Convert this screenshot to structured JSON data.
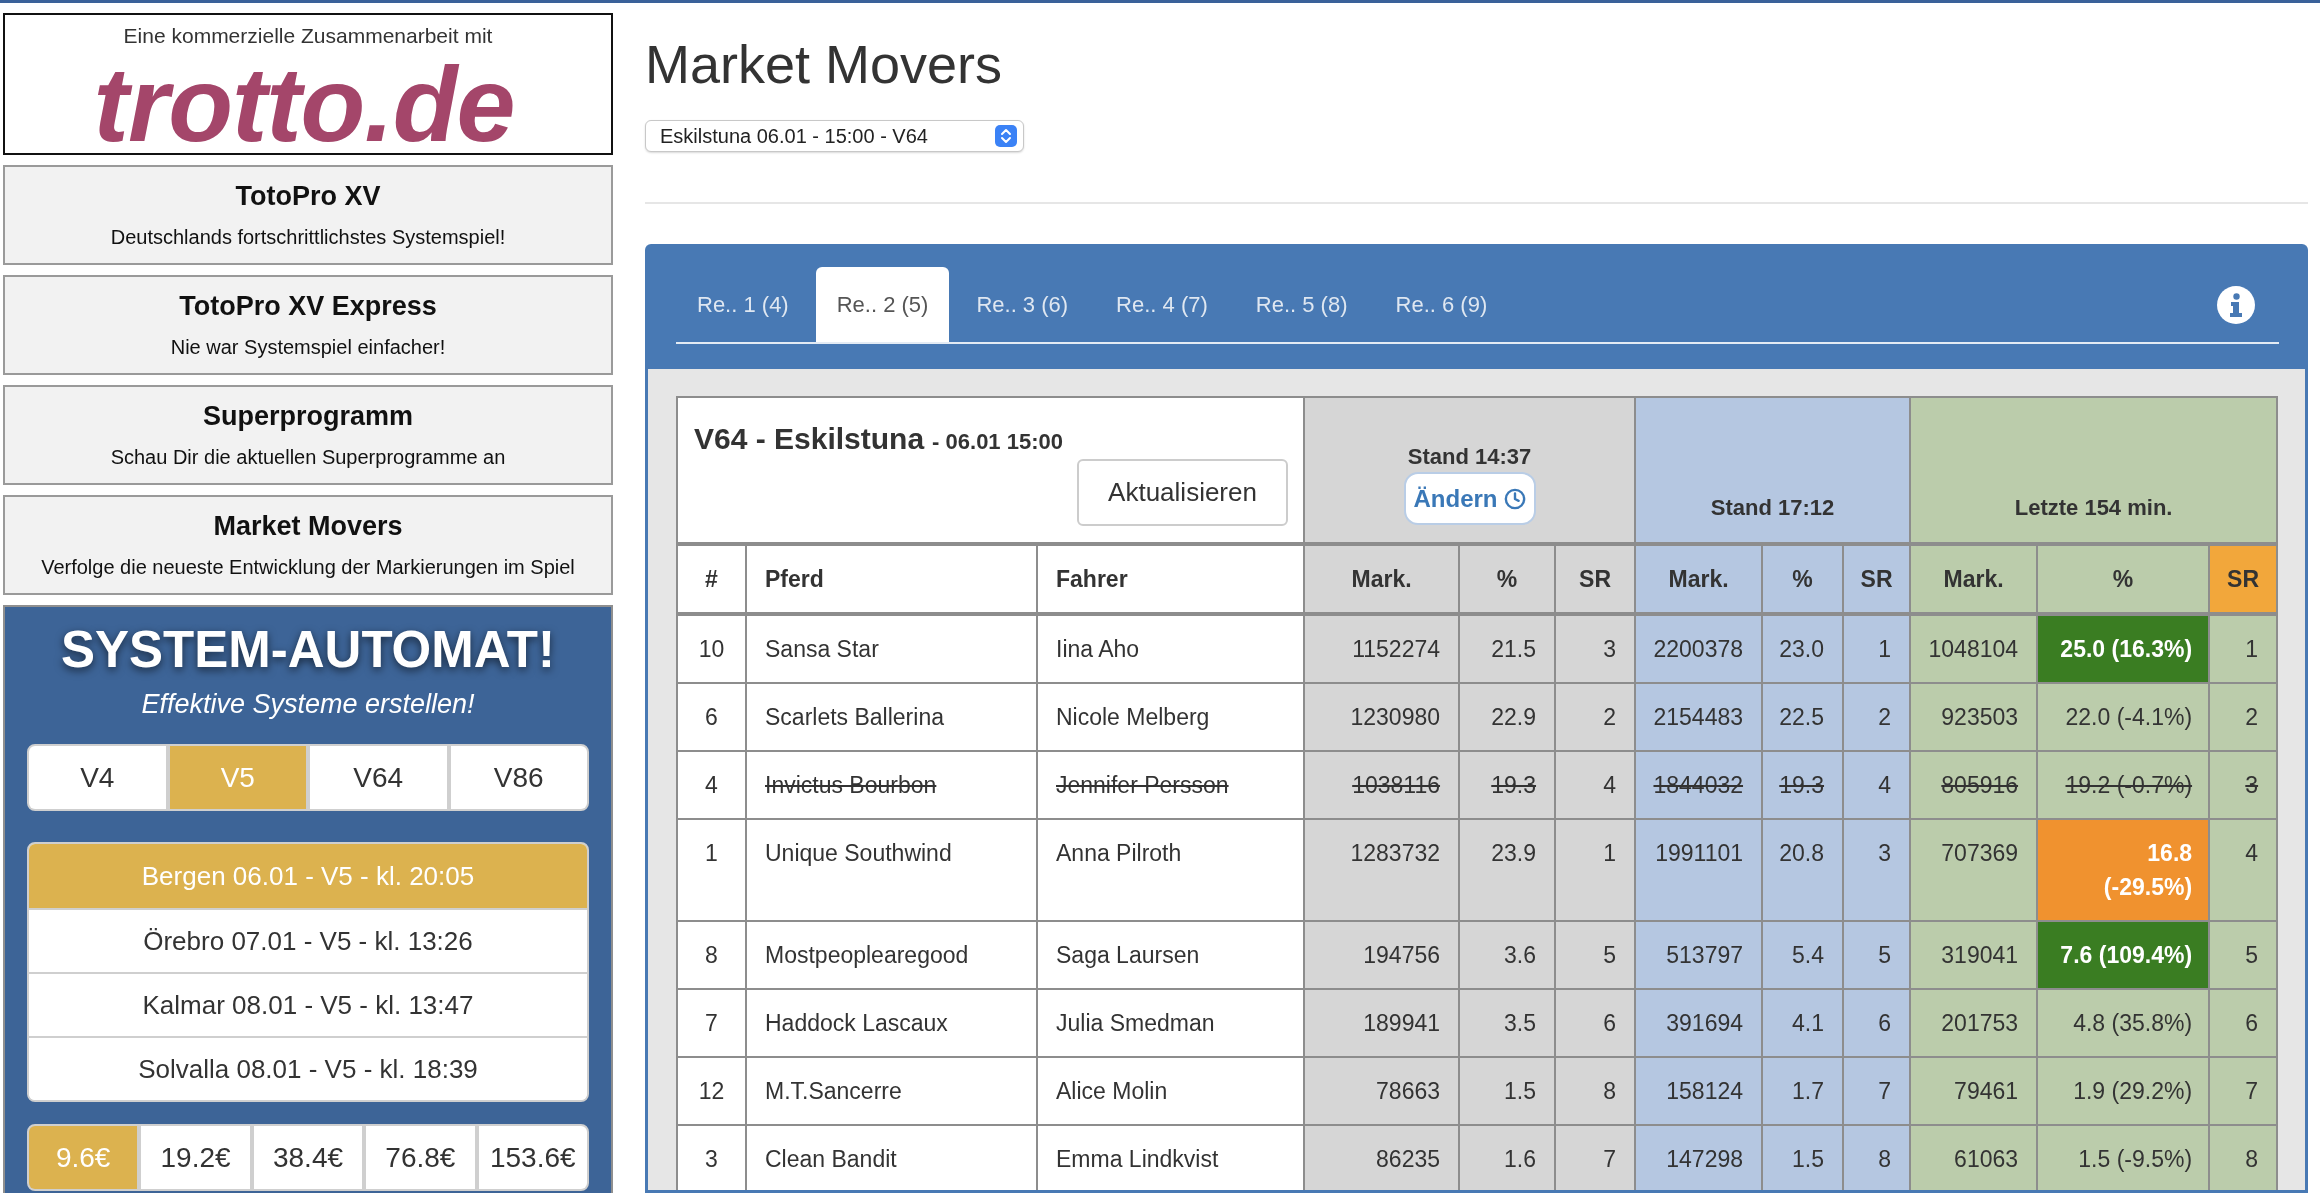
{
  "partner_banner": {
    "caption": "Eine kommerzielle Zusammenarbeit mit",
    "logo": "trotto.de"
  },
  "promo_links": [
    {
      "title": "TotoPro XV",
      "subtitle": "Deutschlands fortschrittlichstes Systemspiel!"
    },
    {
      "title": "TotoPro XV Express",
      "subtitle": "Nie war Systemspiel einfacher!"
    },
    {
      "title": "Superprogramm",
      "subtitle": "Schau Dir die aktuellen Superprogramme an"
    },
    {
      "title": "Market Movers",
      "subtitle": "Verfolge die neueste Entwicklung der Markierungen im Spiel"
    }
  ],
  "system_automat": {
    "title": "SYSTEM-AUTOMAT!",
    "subtitle": "Effektive Systeme erstellen!",
    "game_types": [
      {
        "label": "V4",
        "selected": false
      },
      {
        "label": "V5",
        "selected": true
      },
      {
        "label": "V64",
        "selected": false
      },
      {
        "label": "V86",
        "selected": false
      }
    ],
    "races": [
      {
        "label": "Bergen 06.01 - V5 - kl. 20:05",
        "selected": true
      },
      {
        "label": "Örebro 07.01 - V5 - kl. 13:26",
        "selected": false
      },
      {
        "label": "Kalmar 08.01 - V5 - kl. 13:47",
        "selected": false
      },
      {
        "label": "Solvalla 08.01 - V5 - kl. 18:39",
        "selected": false
      }
    ],
    "stakes": [
      {
        "label": "9.6€",
        "selected": true
      },
      {
        "label": "19.2€",
        "selected": false
      },
      {
        "label": "38.4€",
        "selected": false
      },
      {
        "label": "76.8€",
        "selected": false
      },
      {
        "label": "153.6€",
        "selected": false
      }
    ]
  },
  "page": {
    "title": "Market Movers",
    "race_select": {
      "value": "Eskilstuna 06.01 - 15:00 - V64"
    }
  },
  "race_tabs": [
    {
      "label": "Re.. 1 (4)",
      "selected": false
    },
    {
      "label": "Re.. 2 (5)",
      "selected": true
    },
    {
      "label": "Re.. 3 (6)",
      "selected": false
    },
    {
      "label": "Re.. 4 (7)",
      "selected": false
    },
    {
      "label": "Re.. 5 (8)",
      "selected": false
    },
    {
      "label": "Re.. 6 (9)",
      "selected": false
    }
  ],
  "table": {
    "title": "V64 - Eskilstuna",
    "subtitle": "- 06.01 15:00",
    "refresh_button": "Aktualisieren",
    "groups": [
      {
        "heading": "Stand 14:37",
        "button": "Ändern",
        "color": "#d6d6d6"
      },
      {
        "heading": "Stand 17:12",
        "color": "#b5c7e1"
      },
      {
        "heading": "Letzte 154 min.",
        "color": "#bbccab"
      }
    ],
    "columns": [
      {
        "label": "#",
        "sorted": false
      },
      {
        "label": "Pferd",
        "sorted": false
      },
      {
        "label": "Fahrer",
        "sorted": false
      },
      {
        "label": "Mark.",
        "sorted": false
      },
      {
        "label": "%",
        "sorted": false
      },
      {
        "label": "SR",
        "sorted": false
      },
      {
        "label": "Mark.",
        "sorted": false
      },
      {
        "label": "%",
        "sorted": false
      },
      {
        "label": "SR",
        "sorted": false
      },
      {
        "label": "Mark.",
        "sorted": false
      },
      {
        "label": "%",
        "sorted": false
      },
      {
        "label": "SR",
        "sorted": true
      }
    ],
    "rows": [
      {
        "number": "10",
        "horse": "Sansa Star",
        "driver": "Iina Aho",
        "scratched": false,
        "values": [
          {
            "kind": "plain",
            "mark": "1152274",
            "pct": "21.5",
            "sr": "3"
          },
          {
            "kind": "plain",
            "mark": "2200378",
            "pct": "23.0",
            "sr": "1"
          },
          {
            "kind": "rise",
            "mark": "1048104",
            "pct": "25.0 (16.3%)",
            "sr": "1"
          }
        ]
      },
      {
        "number": "6",
        "horse": "Scarlets Ballerina",
        "driver": "Nicole Melberg",
        "scratched": false,
        "values": [
          {
            "kind": "plain",
            "mark": "1230980",
            "pct": "22.9",
            "sr": "2"
          },
          {
            "kind": "plain",
            "mark": "2154483",
            "pct": "22.5",
            "sr": "2"
          },
          {
            "kind": "plain",
            "mark": "923503",
            "pct": "22.0 (-4.1%)",
            "sr": "2"
          }
        ]
      },
      {
        "number": "4",
        "horse": "Invictus Bourbon",
        "driver": "Jennifer Persson",
        "scratched": true,
        "values": [
          {
            "kind": "plain",
            "mark": "1038116",
            "pct": "19.3",
            "sr": "4"
          },
          {
            "kind": "plain",
            "mark": "1844032",
            "pct": "19.3",
            "sr": "4"
          },
          {
            "kind": "plain",
            "mark": "805916",
            "pct": "19.2 (-0.7%)",
            "sr": "3"
          }
        ]
      },
      {
        "number": "1",
        "horse": "Unique Southwind",
        "driver": "Anna Pilroth",
        "scratched": false,
        "values": [
          {
            "kind": "plain",
            "mark": "1283732",
            "pct": "23.9",
            "sr": "1"
          },
          {
            "kind": "plain",
            "mark": "1991101",
            "pct": "20.8",
            "sr": "3"
          },
          {
            "kind": "fall",
            "mark": "707369",
            "pct": "16.8 (-29.5%)",
            "sr": "4"
          }
        ]
      },
      {
        "number": "8",
        "horse": "Mostpeoplearegood",
        "driver": "Saga Laursen",
        "scratched": false,
        "values": [
          {
            "kind": "plain",
            "mark": "194756",
            "pct": "3.6",
            "sr": "5"
          },
          {
            "kind": "plain",
            "mark": "513797",
            "pct": "5.4",
            "sr": "5"
          },
          {
            "kind": "rise",
            "mark": "319041",
            "pct": "7.6 (109.4%)",
            "sr": "5"
          }
        ]
      },
      {
        "number": "7",
        "horse": "Haddock Lascaux",
        "driver": "Julia Smedman",
        "scratched": false,
        "values": [
          {
            "kind": "plain",
            "mark": "189941",
            "pct": "3.5",
            "sr": "6"
          },
          {
            "kind": "plain",
            "mark": "391694",
            "pct": "4.1",
            "sr": "6"
          },
          {
            "kind": "plain",
            "mark": "201753",
            "pct": "4.8 (35.8%)",
            "sr": "6"
          }
        ]
      },
      {
        "number": "12",
        "horse": "M.T.Sancerre",
        "driver": "Alice Molin",
        "scratched": false,
        "values": [
          {
            "kind": "plain",
            "mark": "78663",
            "pct": "1.5",
            "sr": "8"
          },
          {
            "kind": "plain",
            "mark": "158124",
            "pct": "1.7",
            "sr": "7"
          },
          {
            "kind": "plain",
            "mark": "79461",
            "pct": "1.9 (29.2%)",
            "sr": "7"
          }
        ]
      },
      {
        "number": "3",
        "horse": "Clean Bandit",
        "driver": "Emma Lindkvist",
        "scratched": false,
        "values": [
          {
            "kind": "plain",
            "mark": "86235",
            "pct": "1.6",
            "sr": "7"
          },
          {
            "kind": "plain",
            "mark": "147298",
            "pct": "1.5",
            "sr": "8"
          },
          {
            "kind": "plain",
            "mark": "61063",
            "pct": "1.5 (-9.5%)",
            "sr": "8"
          }
        ]
      }
    ]
  }
}
